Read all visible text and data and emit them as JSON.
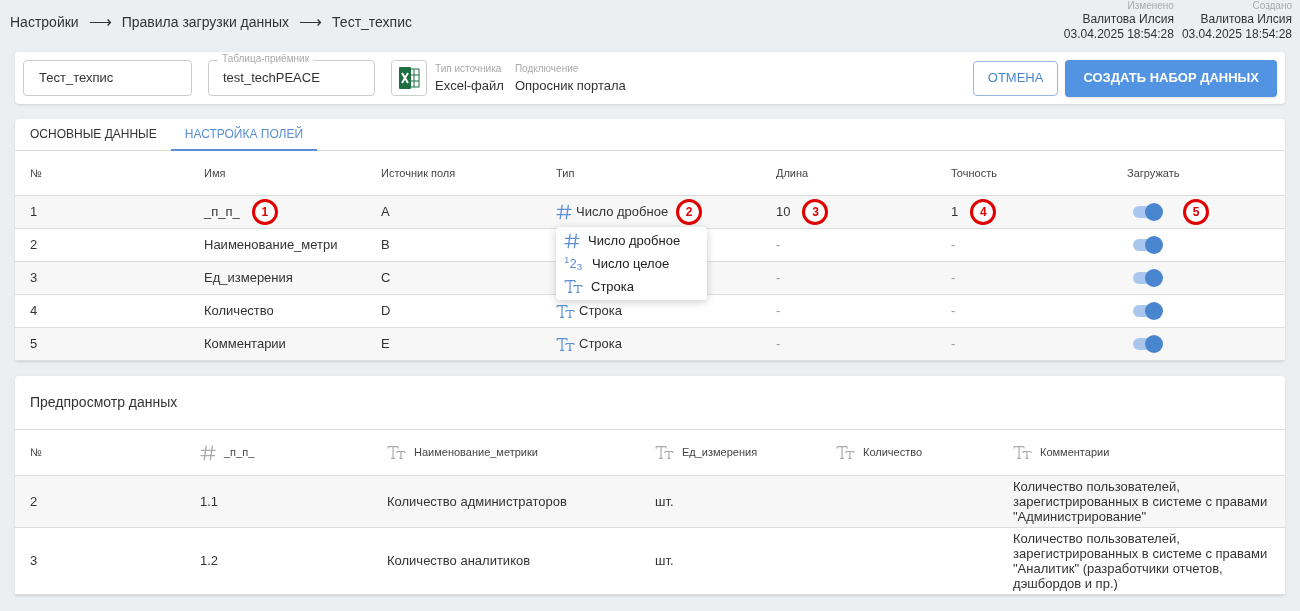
{
  "breadcrumb": [
    "Настройки",
    "Правила загрузки данных",
    "Тест_техпис"
  ],
  "breadcrumb_separator": "⟶",
  "meta": [
    {
      "label": "Изменено",
      "user": "Валитова Илсия",
      "date": "03.04.2025 18:54:28"
    },
    {
      "label": "Создано",
      "user": "Валитова Илсия",
      "date": "03.04.2025 18:54:28"
    }
  ],
  "header": {
    "name_field": {
      "value": "Тест_техпис"
    },
    "target_field": {
      "label": "Таблица-приёмник",
      "value": "test_techPEACE"
    },
    "source_type": {
      "label": "Тип источника",
      "value": "Excel-файл"
    },
    "connection": {
      "label": "Подключение",
      "value": "Опросник портала"
    },
    "buttons": [
      {
        "label": "ОТМЕНА",
        "kind": "outline"
      },
      {
        "label": "СОЗДАТЬ НАБОР ДАННЫХ",
        "kind": "primary"
      }
    ]
  },
  "tabs": [
    {
      "label": "ОСНОВНЫЕ ДАННЫЕ",
      "selected": false
    },
    {
      "label": "НАСТРОЙКА ПОЛЕЙ",
      "selected": true
    }
  ],
  "fields_table": {
    "columns": [
      "№",
      "Имя",
      "Источник поля",
      "Тип",
      "Длина",
      "Точность",
      "Загружать"
    ],
    "rows": [
      {
        "no": "1",
        "name": "_п_п_",
        "source": "A",
        "type": {
          "kind": "decimal",
          "label": "Число дробное"
        },
        "length": "10",
        "precision": "1",
        "load": true,
        "callouts": {
          "name": "1",
          "type": "2",
          "length": "3",
          "precision": "4",
          "load": "5"
        }
      },
      {
        "no": "2",
        "name": "Наименование_метри",
        "source": "B",
        "length": "-",
        "precision": "-",
        "load": true
      },
      {
        "no": "3",
        "name": "Ед_измерения",
        "source": "C",
        "length": "-",
        "precision": "-",
        "load": true
      },
      {
        "no": "4",
        "name": "Количество",
        "source": "D",
        "type": {
          "kind": "string",
          "label": "Строка"
        },
        "length": "-",
        "precision": "-",
        "load": true
      },
      {
        "no": "5",
        "name": "Комментарии",
        "source": "E",
        "type": {
          "kind": "string",
          "label": "Строка"
        },
        "length": "-",
        "precision": "-",
        "load": true
      }
    ]
  },
  "type_menu": [
    {
      "kind": "decimal",
      "label": "Число дробное"
    },
    {
      "kind": "integer",
      "icon_text": "$^{1}$2$_{3}$",
      "label": "Число целое"
    },
    {
      "kind": "string",
      "label": "Строка"
    }
  ],
  "preview": {
    "title": "Предпросмотр данных",
    "columns": [
      {
        "label": "№"
      },
      {
        "kind": "decimal",
        "label": "_п_п_"
      },
      {
        "kind": "string",
        "label": "Наименование_метрики"
      },
      {
        "kind": "string",
        "label": "Ед_измерения"
      },
      {
        "kind": "string",
        "label": "Количество"
      },
      {
        "kind": "string",
        "label": "Комментарии"
      }
    ],
    "rows": [
      [
        "2",
        "1.1",
        "Количество администраторов",
        "шт.",
        "",
        "Количество пользователей, зарегистрированных в системе с правами \"Администрирование\""
      ],
      [
        "3",
        "1.2",
        "Количество аналитиков",
        "шт.",
        "",
        "Количество пользователей, зарегистрированных в системе с правами \"Аналитик\" (разработчики отчетов, дэшбордов и пр.)"
      ]
    ]
  }
}
